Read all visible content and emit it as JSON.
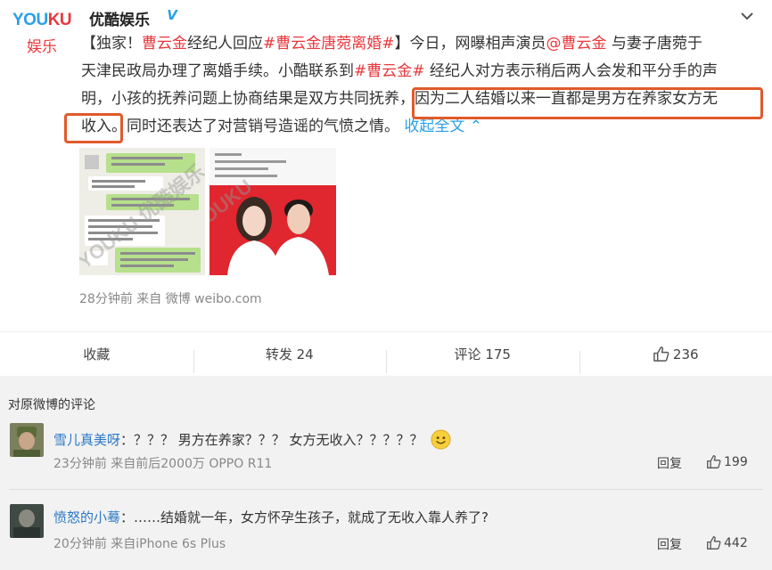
{
  "header": {
    "logo_text_you": "YOU",
    "logo_text_ku": "KU",
    "logo_text_cn": "娱乐",
    "author": "优酷娱乐",
    "verified_badge": "V"
  },
  "post": {
    "line1": {
      "a": "【独家！",
      "tag_name": "曹云金",
      "b": "经纪人回应",
      "tag_divorce": "#曹云金唐菀离婚#",
      "c": "】今日，网曝相声演员",
      "at_user": "@曹云金",
      "d": " 与妻子唐菀于"
    },
    "line2": {
      "a": "天津民政局办理了离婚手续。小酷联系到",
      "tag": "#曹云金#",
      "b": " 经纪人对方表示稍后两人会发和平分手的声"
    },
    "line3": "明，小孩的抚养问题上协商结果是双方共同抚养，因为二人结婚以来一直都是男方在养家女方无",
    "line4": {
      "a": "收入。",
      "b": "同时还表达了对营销号造谣的气愤之情。",
      "collapse": "收起全文",
      "collapse_arrow": "⌃"
    },
    "image1_watermark": "YOUKU 优酷娱乐",
    "image2_watermark": "YOUKU",
    "meta": "28分钟前  来自 微博 weibo.com"
  },
  "actions": {
    "favorite": "收藏",
    "repost": "转发 24",
    "comment": "评论 175",
    "like": "236"
  },
  "comments_section": {
    "title": "对原微博的评论",
    "comments": [
      {
        "user": "雪儿真美呀",
        "text": "：？？？ 男方在养家？？？ 女方无收入？？？？？",
        "meta": "23分钟前  来自前后2000万 OPPO R11",
        "reply": "回复",
        "likes": "199"
      },
      {
        "user": "愤怒的小蓦",
        "text": "：……结婚就一年，女方怀孕生孩子，就成了无收入靠人养了?",
        "meta": "20分钟前  来自iPhone 6s Plus",
        "reply": "回复",
        "likes": "442"
      }
    ]
  },
  "colors": {
    "link_blue": "#2aa0e6",
    "tag_red": "#e8383d",
    "highlight_box": "#e05a2a",
    "username_blue": "#2a78c6",
    "comment_bg": "#f2f2f2"
  },
  "icons": [
    "chevron-down-icon",
    "thumbs-up-icon",
    "smile-emoji-icon",
    "verified-icon"
  ]
}
